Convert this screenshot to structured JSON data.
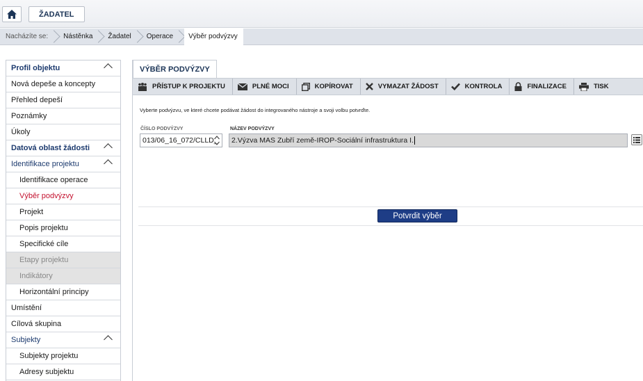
{
  "topbar": {
    "zadatel_label": "ŽADATEL"
  },
  "breadcrumb": {
    "prefix": "Nacházíte se:",
    "items": [
      "Nástěnka",
      "Žadatel",
      "Operace",
      "Výběr podvýzvy"
    ]
  },
  "sidebar": {
    "items": [
      {
        "label": "Profil objektu"
      },
      {
        "label": "Nová depeše a koncepty"
      },
      {
        "label": "Přehled depeší"
      },
      {
        "label": "Poznámky"
      },
      {
        "label": "Úkoly"
      },
      {
        "label": "Datová oblast žádosti"
      },
      {
        "label": "Identifikace projektu"
      },
      {
        "label": "Identifikace operace"
      },
      {
        "label": "Výběr podvýzvy"
      },
      {
        "label": "Projekt"
      },
      {
        "label": "Popis projektu"
      },
      {
        "label": "Specifické cíle"
      },
      {
        "label": "Etapy projektu"
      },
      {
        "label": "Indikátory"
      },
      {
        "label": "Horizontální principy"
      },
      {
        "label": "Umístění"
      },
      {
        "label": "Cílová skupina"
      },
      {
        "label": "Subjekty"
      },
      {
        "label": "Subjekty projektu"
      },
      {
        "label": "Adresy subjektu"
      }
    ]
  },
  "main": {
    "tab_title": "VÝBĚR PODVÝZVY",
    "toolbar": {
      "pristup": "PŘÍSTUP K PROJEKTU",
      "plne_moci": "PLNÉ MOCI",
      "kopirovat": "KOPÍROVAT",
      "vymazat": "VYMAZAT ŽÁDOST",
      "kontrola": "KONTROLA",
      "finalizace": "FINALIZACE",
      "tisk": "TISK"
    },
    "instruction": "Vyberte podvýzvu, ve které chcete podávat žádost do integrovaného nástroje a svoji volbu potvrďte.",
    "cislo_label": "ČÍSLO PODVÝZVY",
    "cislo_value": "013/06_16_072/CLLD_",
    "nazev_label": "NÁZEV PODVÝZVY",
    "nazev_value": "2.Výzva MAS Zubří země-IROP-Sociální infrastruktura I.",
    "confirm_label": "Potvrdit výběr"
  },
  "colors": {
    "accent": "#1e3d86",
    "active_link": "#c4122f",
    "header_text": "#1c3a6e"
  }
}
